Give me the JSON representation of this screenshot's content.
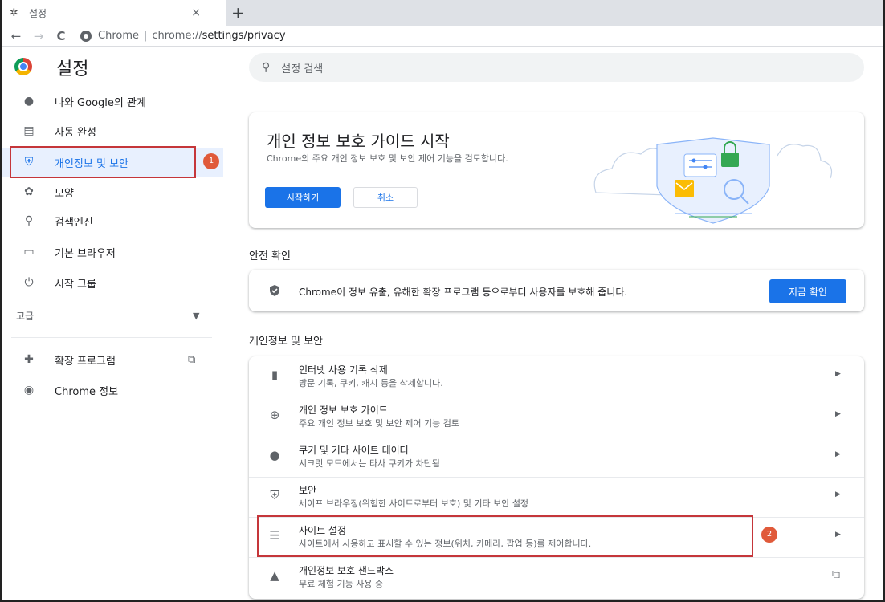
{
  "tab": {
    "icon": "gear-icon",
    "title": "설정",
    "close": "×",
    "new_tab": "+"
  },
  "toolbar": {
    "back": "←",
    "forward": "→",
    "reload": "C",
    "site_label": "Chrome",
    "url_prefix": "chrome://",
    "url_path": "settings/privacy"
  },
  "header": {
    "title": "설정",
    "search_placeholder": "설정 검색"
  },
  "sidebar": {
    "items": [
      {
        "icon": "person-icon",
        "label": "나와 Google의 관계"
      },
      {
        "icon": "autofill-icon",
        "label": "자동 완성"
      },
      {
        "icon": "shield-icon",
        "label": "개인정보 및 보안"
      },
      {
        "icon": "palette-icon",
        "label": "모양"
      },
      {
        "icon": "search-icon",
        "label": "검색엔진"
      },
      {
        "icon": "browser-icon",
        "label": "기본 브라우저"
      },
      {
        "icon": "power-icon",
        "label": "시작 그룹"
      }
    ],
    "advanced": "고급",
    "extensions": "확장 프로그램",
    "about": "Chrome 정보",
    "badge_1": "1"
  },
  "guide": {
    "title": "개인 정보 보호 가이드 시작",
    "desc": "Chrome의 주요 개인 정보 보호 및 보안 제어 기능을 검토합니다.",
    "start": "시작하기",
    "cancel": "취소"
  },
  "safety": {
    "header": "안전 확인",
    "text": "Chrome이 정보 유출, 유해한 확장 프로그램 등으로부터 사용자를 보호해 줍니다.",
    "button": "지금 확인"
  },
  "privacy": {
    "header": "개인정보 및 보안",
    "rows": [
      {
        "icon": "trash-icon",
        "title": "인터넷 사용 기록 삭제",
        "sub": "방문 기록, 쿠키, 캐시 등을 삭제합니다."
      },
      {
        "icon": "guide-icon",
        "title": "개인 정보 보호 가이드",
        "sub": "주요 개인 정보 보호 및 보안 제어 기능 검토"
      },
      {
        "icon": "cookie-icon",
        "title": "쿠키 및 기타 사이트 데이터",
        "sub": "시크릿 모드에서는 타사 쿠키가 차단됨"
      },
      {
        "icon": "security-shield-icon",
        "title": "보안",
        "sub": "세이프 브라우징(위험한 사이트로부터 보호) 및 기타 보안 설정"
      },
      {
        "icon": "tune-icon",
        "title": "사이트 설정",
        "sub": "사이트에서 사용하고 표시할 수 있는 정보(위치, 카메라, 팝업 등)를 제어합니다."
      },
      {
        "icon": "flask-icon",
        "title": "개인정보 보호 샌드박스",
        "sub": "무료 체험 기능 사용 중"
      }
    ],
    "badge_2": "2"
  }
}
